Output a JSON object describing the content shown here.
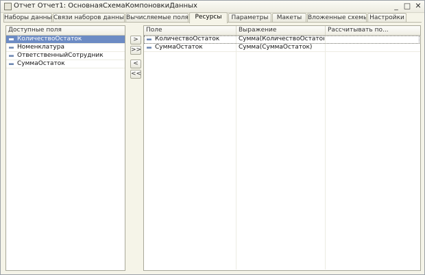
{
  "window": {
    "title": "Отчет Отчет1: ОсновнаяСхемаКомпоновкиДанных"
  },
  "controls": {
    "minimize": "_",
    "maximize": "□",
    "close": "✕"
  },
  "tabs": [
    {
      "label": "Наборы данных"
    },
    {
      "label": "Связи наборов данных"
    },
    {
      "label": "Вычисляемые поля"
    },
    {
      "label": "Ресурсы",
      "active": true
    },
    {
      "label": "Параметры"
    },
    {
      "label": "Макеты"
    },
    {
      "label": "Вложенные схемы"
    },
    {
      "label": "Настройки"
    }
  ],
  "available": {
    "header": "Доступные поля",
    "items": [
      {
        "label": "КоличествоОстаток",
        "selected": true
      },
      {
        "label": "Номенклатура"
      },
      {
        "label": "ОтветственныйСотрудник"
      },
      {
        "label": "СуммаОстаток"
      }
    ]
  },
  "move_buttons": {
    "add": ">",
    "add_all": ">>",
    "remove": "<",
    "remove_all": "<<"
  },
  "resources": {
    "columns": [
      "Поле",
      "Выражение",
      "Рассчитывать по..."
    ],
    "rows": [
      {
        "field": "КоличествоОстаток",
        "expression": "Сумма(КоличествоОстаток)",
        "calc_by": ""
      },
      {
        "field": "СуммаОстаток",
        "expression": "Сумма(СуммаОстаток)",
        "calc_by": ""
      }
    ]
  },
  "colors": {
    "selection": "#6c8bc4",
    "window_bg": "#f5f4e8"
  }
}
